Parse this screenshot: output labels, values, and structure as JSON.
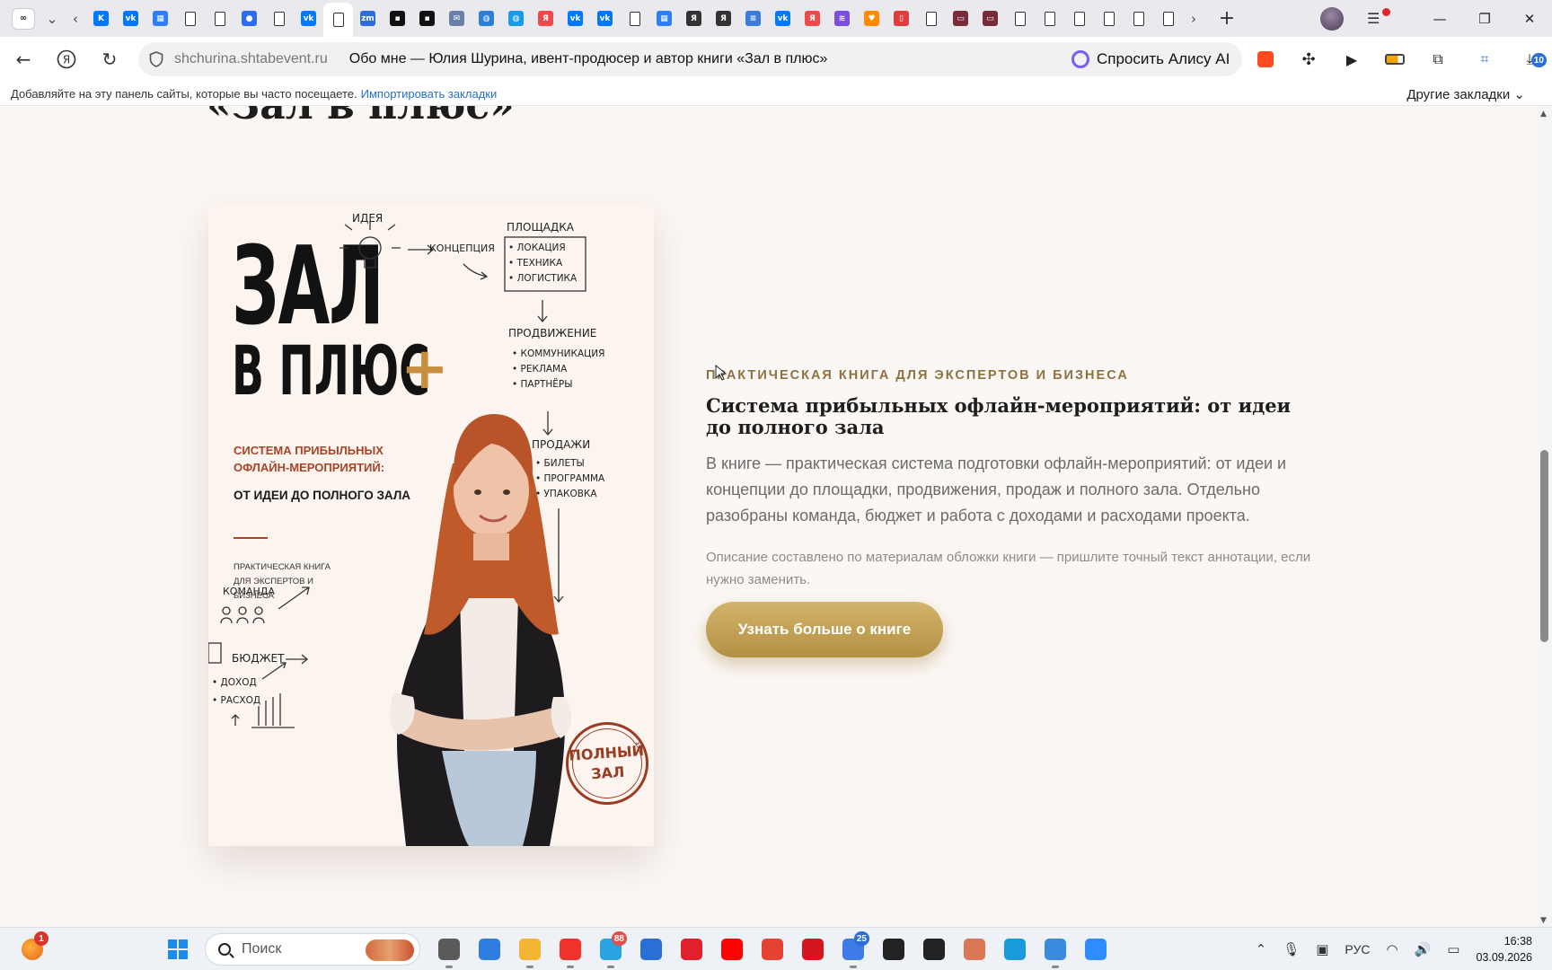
{
  "browser": {
    "pinned_tab_glyph": "∞",
    "tabs": [
      {
        "icon": "vk-icon",
        "glyph": "K",
        "color": "#0077ff"
      },
      {
        "icon": "vk-icon",
        "glyph": "vk",
        "color": "#0077ff"
      },
      {
        "icon": "grid-icon",
        "glyph": "▦",
        "color": "#2d7ff9"
      },
      {
        "icon": "document-icon",
        "glyph": "",
        "color": "#333"
      },
      {
        "icon": "document-icon",
        "glyph": "",
        "color": "#333"
      },
      {
        "icon": "chat-icon",
        "glyph": "●",
        "color": "#2b6cf0"
      },
      {
        "icon": "document-icon",
        "glyph": "",
        "color": "#333"
      },
      {
        "icon": "vk-icon",
        "glyph": "vk",
        "color": "#0077ff"
      },
      {
        "icon": "document-icon",
        "glyph": "",
        "color": "#333",
        "active": true
      },
      {
        "icon": "zoom-meetings-icon",
        "glyph": "zm",
        "color": "#2d6cdf"
      },
      {
        "icon": "video-icon",
        "glyph": "▪",
        "color": "#111"
      },
      {
        "icon": "video-icon",
        "glyph": "▪",
        "color": "#111"
      },
      {
        "icon": "mail-icon",
        "glyph": "✉",
        "color": "#6b7fa8"
      },
      {
        "icon": "globe-icon",
        "glyph": "◍",
        "color": "#2d7fd8"
      },
      {
        "icon": "globe-icon",
        "glyph": "◍",
        "color": "#1a9be8"
      },
      {
        "icon": "yandex-icon",
        "glyph": "Я",
        "color": "#f0494b"
      },
      {
        "icon": "vk-icon",
        "glyph": "vk",
        "color": "#0077ff"
      },
      {
        "icon": "vk-icon",
        "glyph": "vk",
        "color": "#0077ff"
      },
      {
        "icon": "document-icon",
        "glyph": "",
        "color": "#333"
      },
      {
        "icon": "grid-icon",
        "glyph": "▦",
        "color": "#2d7ff9"
      },
      {
        "icon": "yandex-icon",
        "glyph": "Я",
        "color": "#333"
      },
      {
        "icon": "yandex-icon",
        "glyph": "Я",
        "color": "#333"
      },
      {
        "icon": "docs-icon",
        "glyph": "≡",
        "color": "#3b7ddd"
      },
      {
        "icon": "vk-icon",
        "glyph": "vk",
        "color": "#0077ff"
      },
      {
        "icon": "yandex-icon",
        "glyph": "Я",
        "color": "#f0494b"
      },
      {
        "icon": "stripes-icon",
        "glyph": "≋",
        "color": "#7d4ce0"
      },
      {
        "icon": "heart-icon",
        "glyph": "♥",
        "color": "#ff8a00"
      },
      {
        "icon": "pdf-icon",
        "glyph": "▯",
        "color": "#e23d3d"
      },
      {
        "icon": "document-icon",
        "glyph": "",
        "color": "#333"
      },
      {
        "icon": "ticket-icon",
        "glyph": "▭",
        "color": "#7a2b3a"
      },
      {
        "icon": "ticket-icon",
        "glyph": "▭",
        "color": "#7a2b3a"
      },
      {
        "icon": "document-icon",
        "glyph": "",
        "color": "#333"
      },
      {
        "icon": "document-icon",
        "glyph": "",
        "color": "#333"
      },
      {
        "icon": "document-icon",
        "glyph": "",
        "color": "#333"
      },
      {
        "icon": "document-icon",
        "glyph": "",
        "color": "#333"
      },
      {
        "icon": "document-icon",
        "glyph": "",
        "color": "#333"
      },
      {
        "icon": "document-icon",
        "glyph": "",
        "color": "#333"
      }
    ],
    "address": {
      "domain": "shchurina.shtabevent.ru",
      "page_title": "Обо мне — Юлия Шурина, ивент-продюсер и автор книги «Зал в плюс»"
    },
    "alice_label": "Спросить Алису AI",
    "downloads_count": "10",
    "bookmarks_bar": {
      "hint": "Добавляйте на эту панель сайты, которые вы часто посещаете.",
      "import_link": "Импортировать закладки",
      "other": "Другие закладки"
    }
  },
  "page": {
    "heading": "«Зал в плюс»",
    "book_cover": {
      "title_line1": "ЗАЛ",
      "title_line2": "В ПЛЮС",
      "plus": "+",
      "subtitle_red": "СИСТЕМА ПРИБЫЛЬНЫХ ОФЛАЙН-МЕРОПРИЯТИЙ:",
      "subtitle_dark": "ОТ ИДЕИ ДО ПОЛНОГО ЗАЛА",
      "small_text": "ПРАКТИЧЕСКАЯ КНИГА ДЛЯ ЭКСПЕРТОВ И БИЗНЕСА",
      "idea": "ИДЕЯ",
      "concept": "КОНЦЕПЦИЯ",
      "venue": "ПЛОЩАДКА",
      "venue_items": [
        "• ЛОКАЦИЯ",
        "• ТЕХНИКА",
        "• ЛОГИСТИКА"
      ],
      "promotion": "ПРОДВИЖЕНИЕ",
      "promotion_items": [
        "• КОММУНИКАЦИЯ",
        "• РЕКЛАМА",
        "• ПАРТНЁРЫ"
      ],
      "sales": "ПРОДАЖИ",
      "sales_items": [
        "• БИЛЕТЫ",
        "• ПРОГРАММА",
        "• УПАКОВКА"
      ],
      "team": "КОМАНДА",
      "budget": "БЮДЖЕТ",
      "budget_items": [
        "• ДОХОД",
        "• РАСХОД"
      ],
      "stamp_line1": "ПОЛНЫЙ",
      "stamp_line2": "ЗАЛ"
    },
    "eyebrow": "ПРАКТИЧЕСКАЯ КНИГА ДЛЯ ЭКСПЕРТОВ И БИЗНЕСА",
    "title": "Система прибыльных офлайн-мероприятий: от идеи до полного зала",
    "lead": "В книге — практическая система подготовки офлайн-мероприятий: от идеи и концепции до площадки, продвижения, продаж и полного зала. Отдельно разобраны команда, бюджет и работа с доходами и расходами проекта.",
    "note": "Описание составлено по материалам обложки книги — пришлите точный текст аннотации, если нужно заменить.",
    "cta": "Узнать больше о книге",
    "scroll_position": 0.55
  },
  "taskbar": {
    "search_placeholder": "Поиск",
    "weather_badge": "1",
    "telegram_badge": "88",
    "app_badge": "25",
    "language": "РУС",
    "time": "16:38",
    "date": "03.09.2026",
    "apps": [
      {
        "icon": "files-icon",
        "color": "#5a5a5a"
      },
      {
        "icon": "m365-icon",
        "color": "#2f7de1"
      },
      {
        "icon": "folder-icon",
        "color": "#f2b632"
      },
      {
        "icon": "yandex-browser-icon",
        "color": "#f0322d"
      },
      {
        "icon": "telegram-icon",
        "color": "#2ba3e0"
      },
      {
        "icon": "feather-icon",
        "color": "#2a6fd6"
      },
      {
        "icon": "opera-icon",
        "color": "#e0202b"
      },
      {
        "icon": "youtube-icon",
        "color": "#ff0000"
      },
      {
        "icon": "todoist-icon",
        "color": "#e44332"
      },
      {
        "icon": "acrobat-icon",
        "color": "#d4171f"
      },
      {
        "icon": "messenger-icon",
        "color": "#3f7be6"
      },
      {
        "icon": "notion-icon",
        "color": "#222"
      },
      {
        "icon": "chatgpt-icon",
        "color": "#222"
      },
      {
        "icon": "claude-icon",
        "color": "#d97757"
      },
      {
        "icon": "edge-icon",
        "color": "#1a9ad8"
      },
      {
        "icon": "notepad-icon",
        "color": "#3a8be0"
      },
      {
        "icon": "zoom-icon",
        "color": "#2d8cff"
      }
    ]
  }
}
